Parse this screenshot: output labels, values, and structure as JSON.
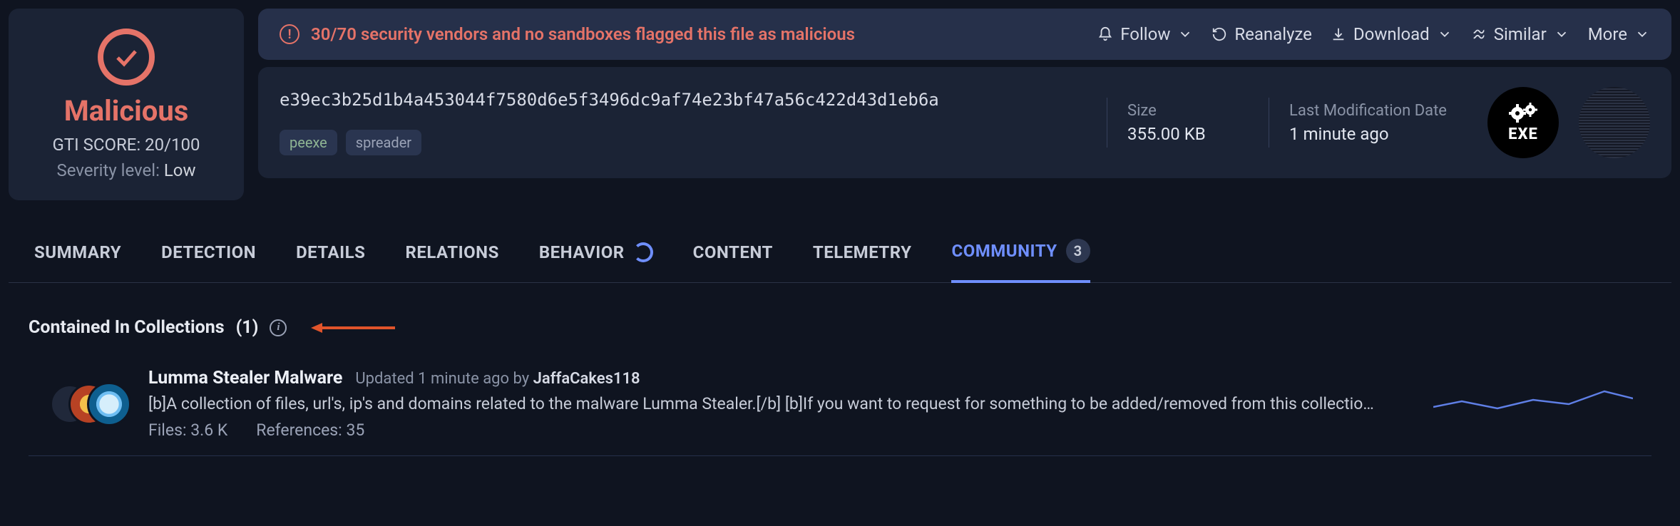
{
  "verdict": {
    "label": "Malicious",
    "gti_score": "GTI SCORE: 20/100",
    "severity_label": "Severity level:",
    "severity_value": "Low"
  },
  "alert": {
    "text": "30/70 security vendors and no sandboxes flagged this file as malicious"
  },
  "actions": {
    "follow": "Follow",
    "reanalyze": "Reanalyze",
    "download": "Download",
    "similar": "Similar",
    "more": "More"
  },
  "file": {
    "hash": "e39ec3b25d1b4a453044f7580d6e5f3496dc9af74e23bf47a56c422d43d1eb6a",
    "tags": [
      "peexe",
      "spreader"
    ],
    "size_label": "Size",
    "size_value": "355.00 KB",
    "mod_label": "Last Modification Date",
    "mod_value": "1 minute ago",
    "ext": "EXE"
  },
  "tabs": {
    "summary": "SUMMARY",
    "detection": "DETECTION",
    "details": "DETAILS",
    "relations": "RELATIONS",
    "behavior": "BEHAVIOR",
    "content": "CONTENT",
    "telemetry": "TELEMETRY",
    "community": "COMMUNITY",
    "community_badge": "3"
  },
  "section": {
    "title": "Contained In Collections",
    "count": "(1)"
  },
  "collection": {
    "title": "Lumma Stealer Malware",
    "updated_prefix": "Updated 1 minute ago by",
    "author": "JaffaCakes118",
    "description": "[b]A collection of files, url's, ip's and domains related to the malware Lumma Stealer.[/b] [b]If you want to request for something to be added/removed from this collectio…",
    "files_label": "Files: 3.6 K",
    "refs_label": "References: 35"
  }
}
